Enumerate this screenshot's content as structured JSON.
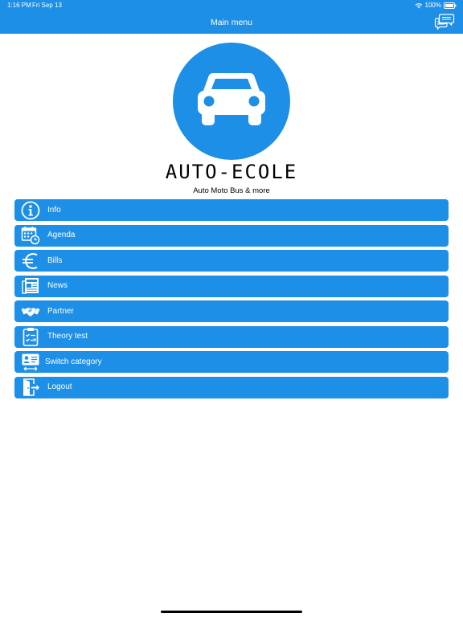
{
  "status_bar": {
    "time": "1:16 PM",
    "date": "Fri Sep 13",
    "battery": "100%"
  },
  "nav": {
    "title": "Main menu",
    "chat_icon": "chat-bubbles-icon"
  },
  "logo": {
    "wordmark": "AUTO-ECOLE",
    "tagline": "Auto Moto Bus & more",
    "icon": "car-icon"
  },
  "menu": {
    "items": [
      {
        "label": "Info",
        "icon": "info-icon"
      },
      {
        "label": "Agenda",
        "icon": "calendar-clock-icon"
      },
      {
        "label": "Bills",
        "icon": "euro-icon"
      },
      {
        "label": "News",
        "icon": "newspaper-icon"
      },
      {
        "label": "Partner",
        "icon": "handshake-icon"
      },
      {
        "label": "Theory test",
        "icon": "clipboard-check-icon"
      },
      {
        "label": "Switch category",
        "icon": "id-card-switch-icon"
      },
      {
        "label": "Logout",
        "icon": "logout-door-icon"
      }
    ]
  },
  "colors": {
    "accent": "#1e8fe6",
    "background": "#ffffff",
    "text_on_accent": "#ffffff"
  }
}
